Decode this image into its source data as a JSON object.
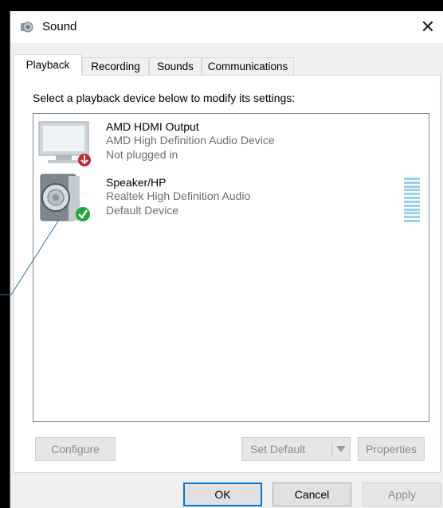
{
  "window": {
    "title": "Sound"
  },
  "tabs": [
    {
      "label": "Playback",
      "active": true
    },
    {
      "label": "Recording",
      "active": false
    },
    {
      "label": "Sounds",
      "active": false
    },
    {
      "label": "Communications",
      "active": false
    }
  ],
  "instruction": "Select a playback device below to modify its settings:",
  "devices": [
    {
      "name": "AMD HDMI Output",
      "description": "AMD High Definition Audio Device",
      "status": "Not plugged in",
      "icon": "monitor-icon",
      "badge": "unplugged-arrow-icon"
    },
    {
      "name": "Speaker/HP",
      "description": "Realtek High Definition Audio",
      "status": "Default Device",
      "icon": "speaker-icon",
      "badge": "default-check-icon"
    }
  ],
  "buttons": {
    "configure": "Configure",
    "set_default": "Set Default",
    "properties": "Properties",
    "ok": "OK",
    "cancel": "Cancel",
    "apply": "Apply"
  },
  "colors": {
    "accent": "#0078d7",
    "meter": "#9dd0ea",
    "default_check": "#1fa83a",
    "unplugged": "#c1272d"
  }
}
